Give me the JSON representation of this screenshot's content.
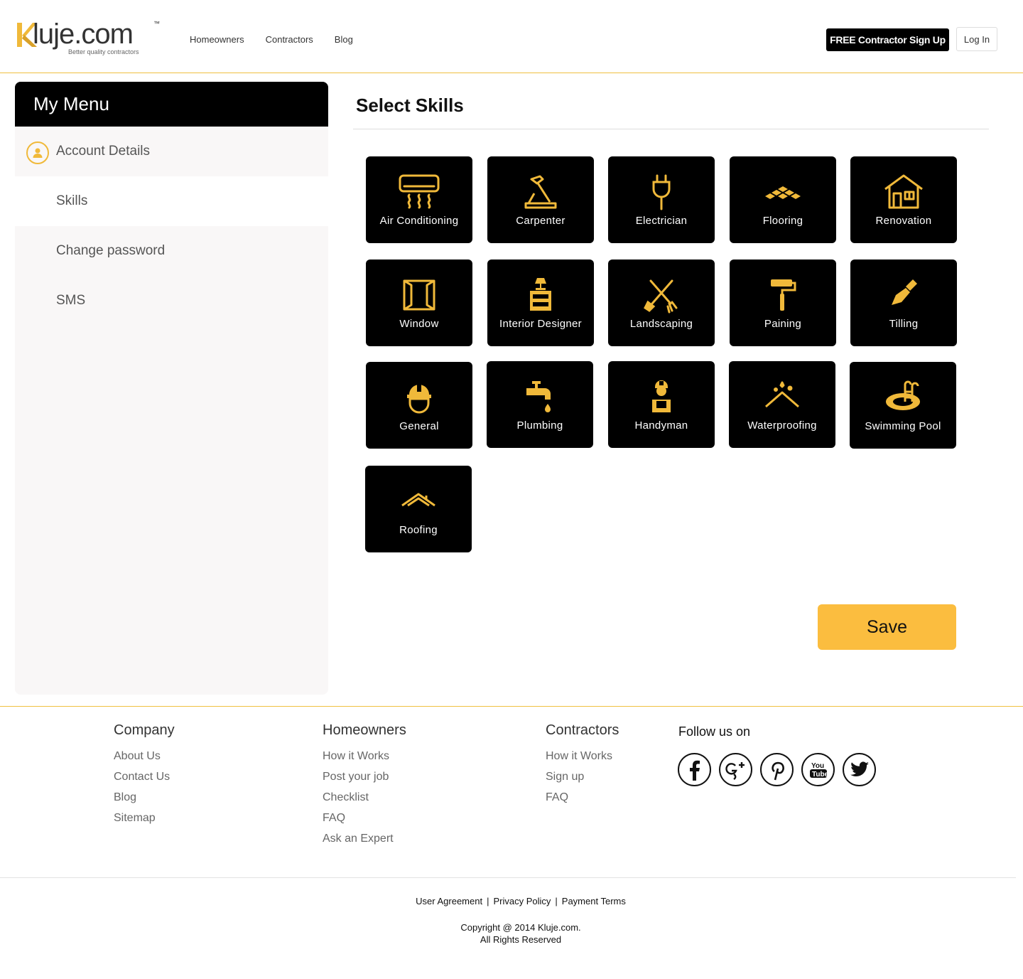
{
  "brand": {
    "name": "Kluje.com",
    "logo_word": "luje.com",
    "tagline": "Better quality contractors",
    "trademark": "™",
    "accent": "#f0b93a"
  },
  "header": {
    "nav": [
      "Homeowners",
      "Contractors",
      "Blog"
    ],
    "signup_label": "FREE Contractor Sign Up",
    "login_label": "Log In"
  },
  "sidebar": {
    "title": "My Menu",
    "items": [
      {
        "label": "Account Details",
        "icon": "user-icon"
      },
      {
        "label": "Skills"
      },
      {
        "label": "Change password"
      },
      {
        "label": "SMS"
      }
    ],
    "active_index": 1
  },
  "main": {
    "title": "Select Skills",
    "skills": [
      {
        "label": "Air Conditioning",
        "icon": "air-conditioner-icon"
      },
      {
        "label": "Carpenter",
        "icon": "hammer-icon"
      },
      {
        "label": "Electrician",
        "icon": "plug-icon"
      },
      {
        "label": "Flooring",
        "icon": "floor-tiles-icon"
      },
      {
        "label": "Renovation",
        "icon": "house-icon"
      },
      {
        "label": "Window",
        "icon": "window-icon"
      },
      {
        "label": "Interior Designer",
        "icon": "lamp-drawer-icon"
      },
      {
        "label": "Landscaping",
        "icon": "shovel-fork-icon"
      },
      {
        "label": "Paining",
        "icon": "paint-roller-icon"
      },
      {
        "label": "Tilling",
        "icon": "trowel-icon"
      },
      {
        "label": "General",
        "icon": "hard-hat-icon"
      },
      {
        "label": "Plumbing",
        "icon": "faucet-icon"
      },
      {
        "label": "Handyman",
        "icon": "worker-icon"
      },
      {
        "label": "Waterproofing",
        "icon": "roof-drops-icon"
      },
      {
        "label": "Swimming Pool",
        "icon": "pool-icon"
      },
      {
        "label": "Roofing",
        "icon": "roof-icon"
      }
    ],
    "save_label": "Save"
  },
  "footer": {
    "company": {
      "title": "Company",
      "links": [
        "About Us",
        "Contact Us",
        "Blog",
        "Sitemap"
      ]
    },
    "homeowners": {
      "title": "Homeowners",
      "links": [
        "How it Works",
        "Post your job",
        "Checklist",
        "FAQ",
        "Ask an Expert"
      ]
    },
    "contractors": {
      "title": "Contractors",
      "links": [
        "How it Works",
        "Sign up",
        "FAQ"
      ]
    },
    "follow": {
      "title": "Follow us on",
      "icons": [
        "facebook-icon",
        "google-plus-icon",
        "pinterest-icon",
        "youtube-icon",
        "twitter-icon"
      ]
    },
    "legal": [
      "User Agreement",
      "Privacy Policy",
      "Payment Terms"
    ],
    "copyright_line1": "Copyright @ 2014 Kluje.com.",
    "copyright_line2": "All Rights Reserved"
  }
}
